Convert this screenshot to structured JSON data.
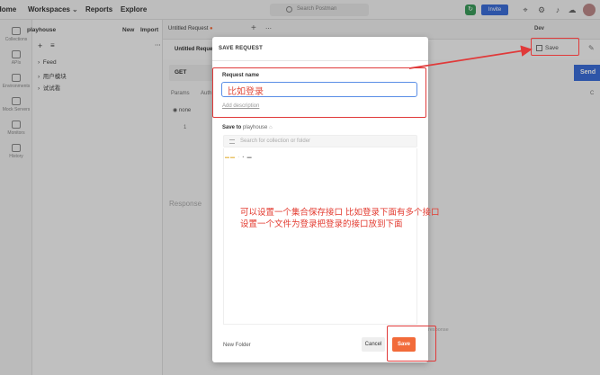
{
  "topbar": {
    "home": "Home",
    "workspaces": "Workspaces",
    "reports": "Reports",
    "explore": "Explore",
    "search_placeholder": "Search Postman",
    "invite": "Invite"
  },
  "rail": {
    "items": [
      "Collections",
      "APIs",
      "Environments",
      "Mock Servers",
      "Monitors",
      "History"
    ]
  },
  "sidebar": {
    "workspace": "playhouse",
    "new": "New",
    "import": "Import",
    "tree": [
      "Feed",
      "用户模块",
      "试试看"
    ]
  },
  "tabs": {
    "active": "Untitled Request",
    "request_title": "Untitled Reque"
  },
  "request": {
    "method": "GET",
    "send": "Send",
    "params": "Params",
    "auth": "Auth",
    "none": "none",
    "response": "Response",
    "response_right": "response",
    "env": "Dev",
    "save": "Save",
    "line_no": "1"
  },
  "modal": {
    "title": "SAVE REQUEST",
    "name_label": "Request name",
    "name_value": "比如登录",
    "add_description": "Add description",
    "save_to_label": "Save to",
    "save_to_workspace": "playhouse",
    "collection_search_placeholder": "Search for collection or folder",
    "new_folder": "New Folder",
    "cancel": "Cancel",
    "save": "Save"
  },
  "annotation": {
    "note": "可以设置一个集合保存接口 比如登录下面有多个接口 设置一个文件为登录把登录的接口放到下面",
    "color": "#e03a3a"
  }
}
